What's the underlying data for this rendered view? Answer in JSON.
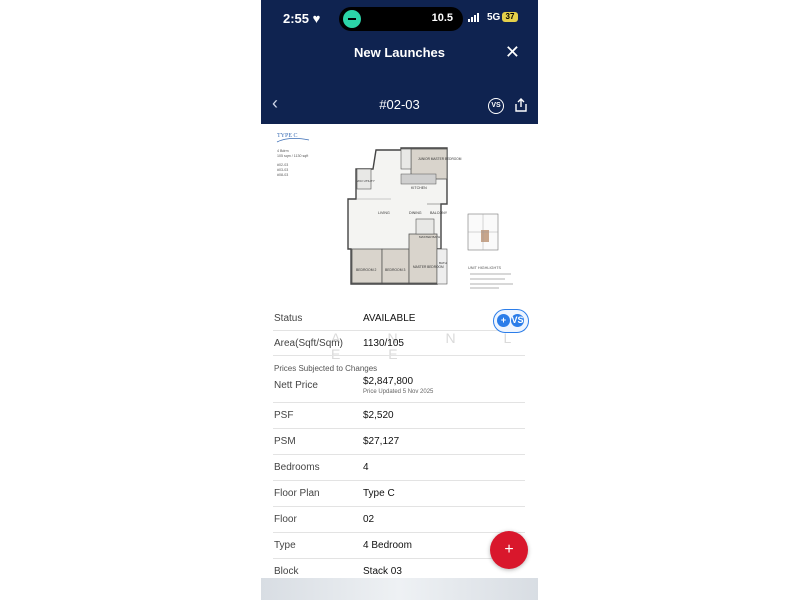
{
  "status_bar": {
    "time": "2:55",
    "island_value": "10.5",
    "network": "5G",
    "battery": "37"
  },
  "header": {
    "title": "New Launches",
    "unit": "#02-03",
    "vs_label": "VS"
  },
  "floor_plan": {
    "type_label": "TYPE C",
    "bedrooms_line": "4 Bdrm",
    "area_line": "105 sqm / 1130 sqft",
    "units": [
      "#02-03",
      "#03-03",
      "#08-03"
    ],
    "rooms": [
      "JUNIOR MASTER BEDROOM",
      "KITCHEN",
      "WC/ UTILITY",
      "LIVING",
      "DINING",
      "BALCONY",
      "MASTER BATH",
      "BEDROOM 2",
      "BEDROOM 3",
      "MASTER BEDROOM",
      "BATH"
    ],
    "highlights_title": "UNIT HIGHLIGHTS"
  },
  "details": {
    "status_label": "Status",
    "status_value": "AVAILABLE",
    "area_label": "Area(Sqft/Sqm)",
    "area_value": "1130/105",
    "prices_note": "Prices Subjected to Changes",
    "nett_label": "Nett Price",
    "nett_value": "$2,847,800",
    "nett_updated": "Price Updated 5 Nov 2025",
    "psf_label": "PSF",
    "psf_value": "$2,520",
    "psm_label": "PSM",
    "psm_value": "$27,127",
    "bedrooms_label": "Bedrooms",
    "bedrooms_value": "4",
    "floorplan_label": "Floor Plan",
    "floorplan_value": "Type C",
    "floor_label": "Floor",
    "floor_value": "02",
    "type_label": "Type",
    "type_value": "4 Bedroom",
    "block_label": "Block",
    "block_value": "Stack 03"
  },
  "watermark": "A N N L E E",
  "fab_label": "+",
  "colors": {
    "header_bg": "#0f2350",
    "accent_blue": "#2b7de9",
    "fab_red": "#d9172c"
  }
}
